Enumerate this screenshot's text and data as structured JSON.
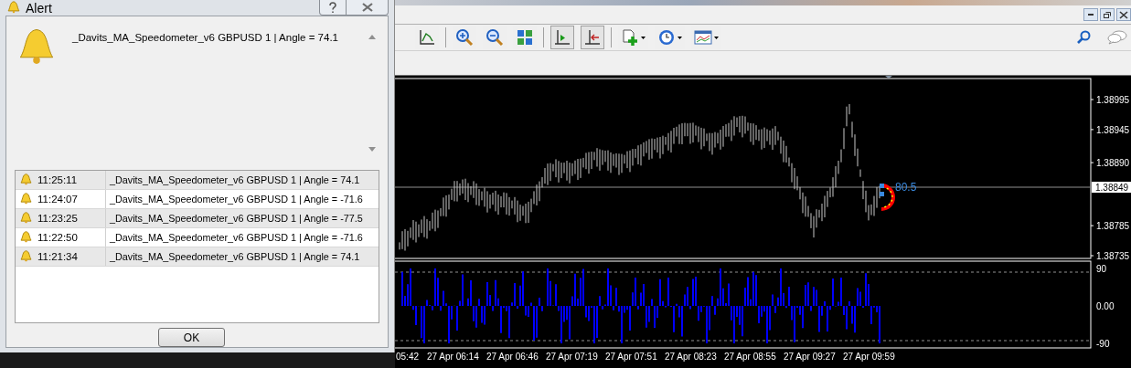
{
  "dialog": {
    "title": "Alert",
    "message": "_Davits_MA_Speedometer_v6 GBPUSD 1 | Angle = 74.1",
    "alerts": [
      {
        "time": "11:25:11",
        "message": "_Davits_MA_Speedometer_v6 GBPUSD 1 | Angle = 74.1"
      },
      {
        "time": "11:24:07",
        "message": "_Davits_MA_Speedometer_v6 GBPUSD 1 | Angle = -71.6"
      },
      {
        "time": "11:23:25",
        "message": "_Davits_MA_Speedometer_v6 GBPUSD 1 | Angle = -77.5"
      },
      {
        "time": "11:22:50",
        "message": "_Davits_MA_Speedometer_v6 GBPUSD 1 | Angle = -71.6"
      },
      {
        "time": "11:21:34",
        "message": "_Davits_MA_Speedometer_v6 GBPUSD 1 | Angle = 74.1"
      }
    ],
    "ok_button": "OK"
  },
  "chart": {
    "price_ticks": [
      "1.38995",
      "1.38945",
      "1.38890",
      "1.38785",
      "1.38735"
    ],
    "current_price": "1.38849",
    "speedometer_reading": "80.5",
    "indicator_ticks": [
      "90",
      "0.00",
      "-90"
    ],
    "time_labels": [
      "05:42",
      "27 Apr 06:14",
      "27 Apr 06:46",
      "27 Apr 07:19",
      "27 Apr 07:51",
      "27 Apr 08:23",
      "27 Apr 08:55",
      "27 Apr 09:27",
      "27 Apr 09:59"
    ]
  }
}
